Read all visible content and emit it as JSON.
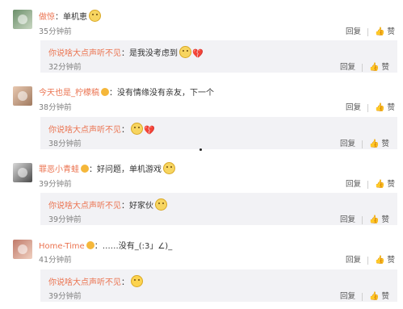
{
  "actions": {
    "reply": "回复",
    "like": "赞"
  },
  "comments": [
    {
      "user": "做惊",
      "text": "：单机恵",
      "time": "35分钟前",
      "reply": {
        "user": "你说啥大点声听不见",
        "text": "：是我没考虑到",
        "time": "32分钟前"
      }
    },
    {
      "user": "今天也是_柠檬稿",
      "text": "：没有情缘没有亲友，下一个",
      "time": "38分钟前",
      "reply": {
        "user": "你说啥大点声听不见",
        "text": "：",
        "time": "38分钟前"
      }
    },
    {
      "user": "罪恶小青蛙",
      "text": "：好问题，单机游戏",
      "time": "39分钟前",
      "reply": {
        "user": "你说啥大点声听不见",
        "text": "：好家伙",
        "time": "39分钟前"
      }
    },
    {
      "user": "Home-Time",
      "text": "：……没有_(:3」∠)_",
      "time": "41分钟前",
      "reply": {
        "user": "你说啥大点声听不见",
        "text": "：",
        "time": "39分钟前"
      }
    }
  ]
}
